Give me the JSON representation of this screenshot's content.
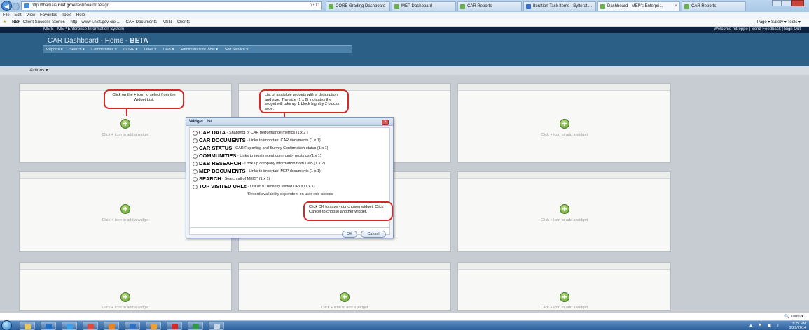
{
  "browser": {
    "url_prefix": "http://fbamais.",
    "url_domain": "nist.gov",
    "url_path": "/dashboard/Design",
    "url_controls": "ρ • C",
    "tabs": [
      {
        "label": "CORE Grading Dashboard"
      },
      {
        "label": "MEP Dashboard"
      },
      {
        "label": "CAR Reports"
      },
      {
        "label": "Iteration Task Items - Bylterati..."
      },
      {
        "label": "Dashboard - MEP's Enterpri..."
      },
      {
        "label": "CAR Reports"
      }
    ],
    "menu": [
      "File",
      "Edit",
      "View",
      "Favorites",
      "Tools",
      "Help"
    ],
    "favorites": [
      "Client Success Stories",
      "http---www-i.nist.gov-cio-...",
      "CAR Documents",
      "MSN",
      "Clients"
    ],
    "favorites_prefix": "NSF",
    "toolbar_right": "Page ▾  Safety ▾  Tools ▾",
    "zoom": "100%"
  },
  "app": {
    "system_name": "MEIS - MEP Enterprise Information System",
    "user_links": "Welcome mtroppe | Send Feedback | Sign Out",
    "title_main": "CAR Dashboard - Home - ",
    "title_beta": "BETA",
    "nav": [
      "Reports ▾",
      "Search ▾",
      "Communities ▾",
      "CORE ▾",
      "Links ▾",
      "D&B ▾",
      "Administration/Tools ▾",
      "Self Service ▾"
    ],
    "actions_label": "Actions",
    "panel_hint": "Click + icon to add a widget"
  },
  "callouts": {
    "plus": "Click on the + icon to select from the Widget List.",
    "list": "List of available widgets with a description and size. The size (1 x 2) indicates the widget will take up 1 block high by 2 blocks wide.",
    "ok": "Click OK to save your chosen widget. Click Cancel to choose another widget."
  },
  "widget_list": {
    "title": "Widget List",
    "options": [
      {
        "name": "CAR DATA",
        "desc": " - Snapshot of CAR performance metrics (1 x 2 )"
      },
      {
        "name": "CAR DOCUMENTS",
        "desc": " - Links to important CAR documents (1 x 1)"
      },
      {
        "name": "CAR STATUS",
        "desc": " - CAR Reporting and Survey Confirmation status (1 x 1)"
      },
      {
        "name": "COMMUNITIES",
        "desc": " - Links to most recent community postings (1 x 1)"
      },
      {
        "name": "D&B RESEARCH",
        "desc": " - Look up company information from D&B (1 x 2)"
      },
      {
        "name": "MEP DOCUMENTS",
        "desc": " - Links to important MEP documents (1 x 1)"
      },
      {
        "name": "SEARCH",
        "desc": " - Search all of MEIS* (1 x 1)"
      },
      {
        "name": "TOP VISITED URLs",
        "desc": " - List of 10 recently visited URLs (1 x 1)"
      }
    ],
    "note": "*Record availability dependent on user role access",
    "ok_label": "OK",
    "cancel_label": "Cancel"
  },
  "taskbar": {
    "time": "3:25 PM",
    "date": "1/29/2014"
  }
}
